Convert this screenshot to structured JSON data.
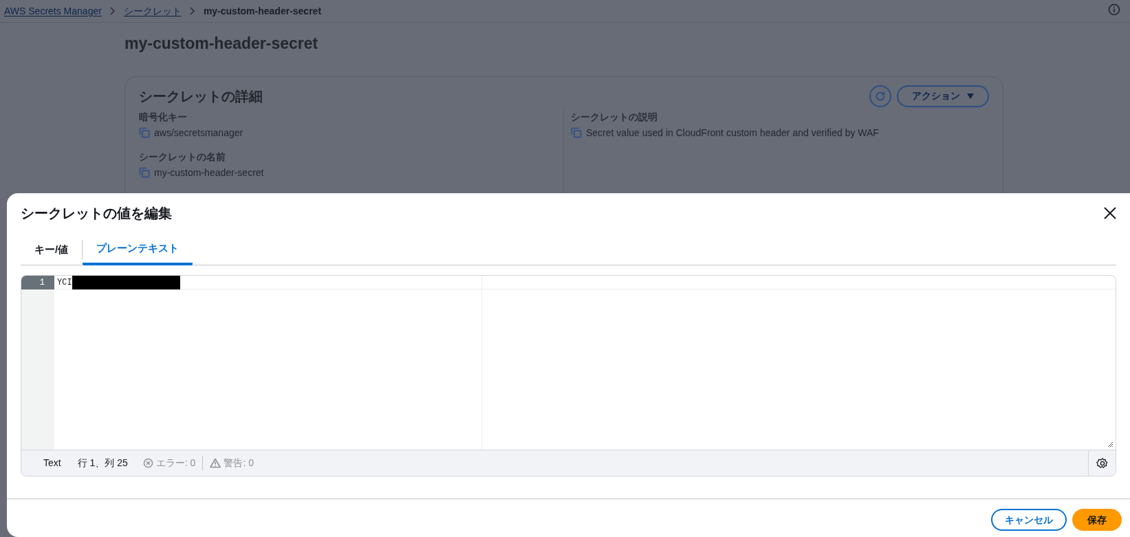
{
  "breadcrumbs": [
    {
      "label": "AWS Secrets Manager",
      "link": true
    },
    {
      "label": "シークレット",
      "link": true
    },
    {
      "label": "my-custom-header-secret",
      "link": false
    }
  ],
  "page_title": "my-custom-header-secret",
  "details_card": {
    "title": "シークレットの詳細",
    "actions_button": "アクション",
    "field_columns": [
      [
        {
          "label": "暗号化キー",
          "value": "aws/secretsmanager"
        },
        {
          "label": "シークレットの名前",
          "value": "my-custom-header-secret"
        }
      ],
      [
        {
          "label": "シークレットの説明",
          "value": "Secret value used in CloudFront custom header and verified by WAF"
        }
      ]
    ]
  },
  "modal": {
    "title": "シークレットの値を編集",
    "tabs": [
      {
        "label": "キー/値",
        "selected": false
      },
      {
        "label": "プレーンテキスト",
        "selected": true
      }
    ],
    "editor": {
      "lines": [
        {
          "number": "1",
          "text": "YCI",
          "redacted": true
        }
      ],
      "status_bar": {
        "mode": "Text",
        "position": "行 1、列 25",
        "errors": "エラー: 0",
        "warnings": "警告: 0"
      }
    },
    "buttons": [
      {
        "label": "キャンセル",
        "kind": "secondary"
      },
      {
        "label": "保存",
        "kind": "primary"
      }
    ]
  }
}
